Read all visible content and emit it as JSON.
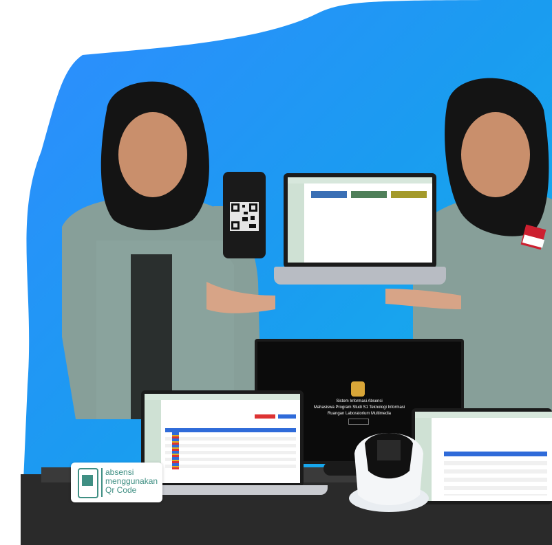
{
  "logo": {
    "line1": "absensi",
    "line2": "menggunakan",
    "line3": "Qr Code"
  },
  "main_monitor": {
    "line1": "Sistem Informasi Absensi",
    "line2": "Mahasiswa Program Studi S1 Teknologi Informasi",
    "line3": "Ruangan Laboratorium Multimedia"
  },
  "colors": {
    "accent_blue": "#1e8bff",
    "teal": "#3f8f83",
    "uniform_gray": "#8aa39d",
    "hijab": "#141414"
  }
}
